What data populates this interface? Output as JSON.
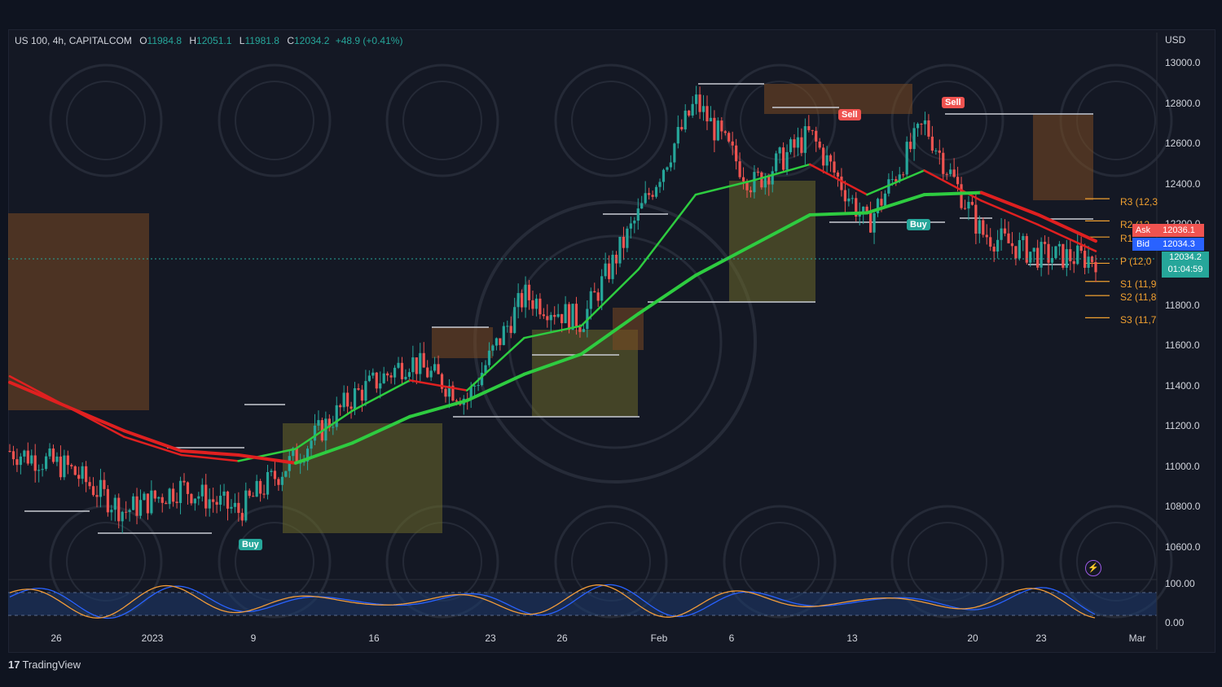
{
  "header": {
    "symbol": "US 100, 4h, CAPITALCOM",
    "o_label": "O",
    "o": "11984.8",
    "h_label": "H",
    "h": "12051.1",
    "l_label": "L",
    "l": "11981.8",
    "c_label": "C",
    "c": "12034.2",
    "change": "+48.9 (+0.41%)"
  },
  "axis": {
    "currency": "USD",
    "price_ticks": [
      "13000.0",
      "12800.0",
      "12600.0",
      "12400.0",
      "12200.0",
      "12000.0",
      "11800.0",
      "11600.0",
      "11400.0",
      "11200.0",
      "11000.0",
      "10800.0",
      "10600.0"
    ],
    "osc_ticks": [
      "100.00",
      "0.00"
    ],
    "time_ticks": [
      "26",
      "2023",
      "9",
      "16",
      "23",
      "26",
      "Feb",
      "6",
      "13",
      "20",
      "23",
      "Mar"
    ]
  },
  "pivots": {
    "r3": "R3 (12,3",
    "r2": "R2 (12,",
    "r1": "R1",
    "p": "P (12,0",
    "s1": "S1 (11,9",
    "s2": "S2 (11,8",
    "s3": "S3 (11,7"
  },
  "quote": {
    "ask_label": "Ask",
    "ask": "12036.1",
    "bid_label": "Bid",
    "bid": "12034.3",
    "last": "12034.2",
    "countdown": "01:04:59"
  },
  "signals": {
    "sell": "Sell",
    "buy": "Buy"
  },
  "brand": {
    "logo": "17",
    "name": "TradingView"
  },
  "colors": {
    "up": "#26a69a",
    "down": "#ef5350",
    "ema_fast": "#2ecc40",
    "ema_slow_bear": "#e02020",
    "pivot": "#f0a030",
    "box_bull": "#6b6a2a",
    "box_bear": "#7a4a22"
  },
  "chart_data": {
    "type": "candlestick",
    "symbol": "US 100",
    "timeframe": "4h",
    "ylim": [
      10550,
      13200
    ],
    "key_levels": {
      "R3": 12330,
      "R2": 12220,
      "R1": 12140,
      "P": 12010,
      "S1": 11920,
      "S2": 11850,
      "S3": 11740
    },
    "trend_path": {
      "x": [
        "Dec 23",
        "Dec 26",
        "Dec 30",
        "Jan 3",
        "Jan 6",
        "Jan 9",
        "Jan 12",
        "Jan 16",
        "Jan 19",
        "Jan 23",
        "Jan 26",
        "Jan 30",
        "Feb 2",
        "Feb 6",
        "Feb 9",
        "Feb 13",
        "Feb 16",
        "Feb 20",
        "Feb 23",
        "Feb 27"
      ],
      "close": [
        11080,
        11000,
        10780,
        10900,
        10780,
        11050,
        11350,
        11530,
        11340,
        11850,
        11720,
        12250,
        12810,
        12400,
        12650,
        12200,
        12700,
        12160,
        12050,
        12034
      ]
    },
    "emas": [
      {
        "values": [
          11450,
          11300,
          11150,
          11060,
          11030,
          11090,
          11280,
          11430,
          11380,
          11640,
          11700,
          11980,
          12350,
          12420,
          12500,
          12350,
          12470,
          12320,
          12200,
          12070
        ]
      },
      {
        "values": [
          11420,
          11300,
          11180,
          11080,
          11060,
          11020,
          11120,
          11250,
          11330,
          11460,
          11560,
          11760,
          11950,
          12100,
          12250,
          12260,
          12350,
          12360,
          12250,
          12120
        ]
      }
    ],
    "signals": [
      {
        "type": "Buy",
        "date": "Jan 8",
        "price": 10720
      },
      {
        "type": "Sell",
        "date": "Feb 10",
        "price": 12720
      },
      {
        "type": "Sell",
        "date": "Feb 16",
        "price": 12800
      },
      {
        "type": "Buy",
        "date": "Feb 16",
        "price": 12300
      }
    ],
    "oscillator": {
      "ylim": [
        0,
        100
      ],
      "levels": [
        20,
        80
      ]
    }
  }
}
